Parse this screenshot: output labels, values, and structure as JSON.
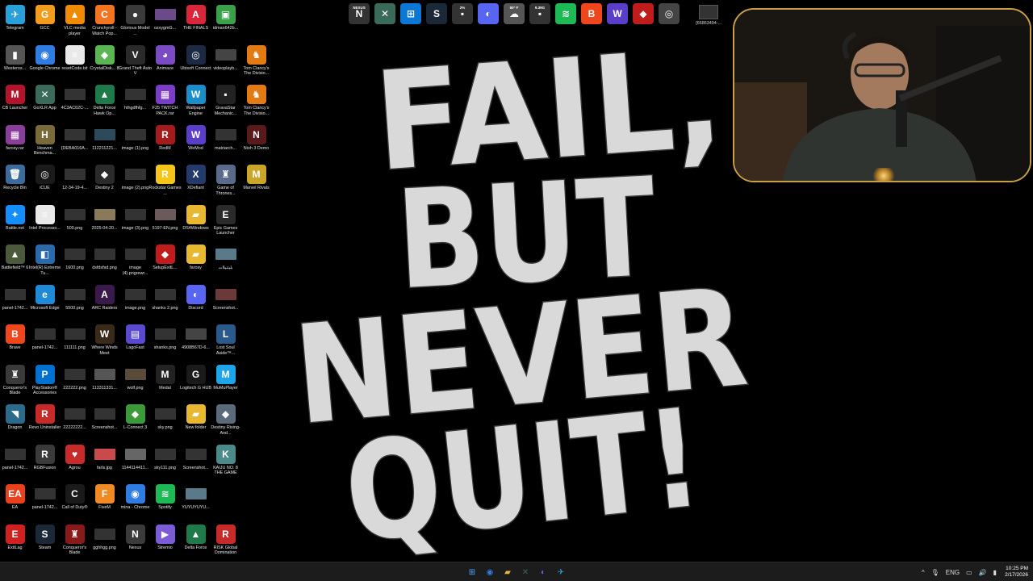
{
  "desktop": {
    "icons": [
      {
        "label": "Telegram",
        "glyph": "✈",
        "color": "#2aa0da",
        "icon": "telegram-icon"
      },
      {
        "label": "GCC",
        "glyph": "G",
        "color": "#f29b1c",
        "icon": "gcc-icon"
      },
      {
        "label": "VLC media player",
        "glyph": "▲",
        "color": "#f08a00",
        "icon": "vlc-icon"
      },
      {
        "label": "Crunchyroll - Watch Pop...",
        "glyph": "C",
        "color": "#f47521",
        "icon": "crunchyroll-icon"
      },
      {
        "label": "Glorious Model ...",
        "glyph": "●",
        "color": "#3a3a3a",
        "icon": "mouse-icon"
      },
      {
        "label": "ozxygmG...",
        "glyph": "☺",
        "color": "#6b4a8a",
        "icon": "image-file-icon"
      },
      {
        "label": "THE FINALS",
        "glyph": "A",
        "color": "#d8263a",
        "icon": "the-finals-icon"
      },
      {
        "label": "idman642b...",
        "glyph": "▣",
        "color": "#3aa04a",
        "icon": "idm-icon"
      },
      {
        "label": "Westeros...",
        "glyph": "▮",
        "color": "#555",
        "icon": "archive-icon"
      },
      {
        "label": "Google Chrome",
        "glyph": "◉",
        "color": "#2f7de1",
        "icon": "chrome-icon"
      },
      {
        "label": "resetCode.txt",
        "glyph": "≡",
        "color": "#e9e9e9",
        "icon": "text-file-icon"
      },
      {
        "label": "CrystalDisk... 8",
        "glyph": "◆",
        "color": "#5ab552",
        "icon": "crystaldisk-icon"
      },
      {
        "label": "Grand Theft Auto V",
        "glyph": "V",
        "color": "#2a2a2a",
        "icon": "gta-icon"
      },
      {
        "label": "Animaze",
        "glyph": "◕",
        "color": "#7a4bc2",
        "icon": "animaze-icon"
      },
      {
        "label": "Ubisoft Connect",
        "glyph": "◎",
        "color": "#1d2a44",
        "icon": "ubisoft-icon"
      },
      {
        "label": "videoplayb...",
        "glyph": "▭",
        "color": "#444",
        "icon": "video-file-icon"
      },
      {
        "label": "Tom Clancy's The Divisio...",
        "glyph": "♞",
        "color": "#e37b14",
        "icon": "division-icon"
      },
      {
        "label": "CB Launcher",
        "glyph": "M",
        "color": "#b3142b",
        "icon": "cb-launcher-icon"
      },
      {
        "label": "GoXLR App",
        "glyph": "✕",
        "color": "#3a6a5a",
        "icon": "goxlr-icon"
      },
      {
        "label": "4C3AC62C-...",
        "glyph": "▭",
        "color": "#333",
        "icon": "image-file-icon"
      },
      {
        "label": "Delta Force Hawk Op...",
        "glyph": "▲",
        "color": "#1f7a4a",
        "icon": "delta-force-icon"
      },
      {
        "label": "hthgdfhfg...",
        "glyph": "▭",
        "color": "#333",
        "icon": "image-file-icon"
      },
      {
        "label": "F25 TWITCH PACK.rar",
        "glyph": "▦",
        "color": "#7b3cc9",
        "icon": "rar-icon"
      },
      {
        "label": "Wallpaper Engine",
        "glyph": "W",
        "color": "#1a8ecb",
        "icon": "wallpaper-engine-icon"
      },
      {
        "label": "GravaStar Mechanic...",
        "glyph": "▪",
        "color": "#222",
        "icon": "gravastar-icon"
      },
      {
        "label": "Tom Clancy's The Divisio...",
        "glyph": "♞",
        "color": "#e37b14",
        "icon": "division-icon"
      },
      {
        "label": "farosy.rar",
        "glyph": "▦",
        "color": "#8a3d9a",
        "icon": "rar-icon"
      },
      {
        "label": "Heaven Benchma...",
        "glyph": "H",
        "color": "#7a6a3a",
        "icon": "heaven-icon"
      },
      {
        "label": "{DEBA016A...",
        "glyph": "▭",
        "color": "#333",
        "icon": "image-file-icon"
      },
      {
        "label": "112211221...",
        "glyph": "▭",
        "color": "#2d4a5a",
        "icon": "image-file-icon"
      },
      {
        "label": "image (1).png",
        "glyph": "▭",
        "color": "#333",
        "icon": "image-file-icon"
      },
      {
        "label": "RedM",
        "glyph": "R",
        "color": "#a51b1b",
        "icon": "redm-icon"
      },
      {
        "label": "WeMod",
        "glyph": "W",
        "color": "#5a3ec9",
        "icon": "wemod-icon"
      },
      {
        "label": "matriarch...",
        "glyph": "▭",
        "color": "#333",
        "icon": "image-file-icon"
      },
      {
        "label": "Nioh 3 Demo",
        "glyph": "N",
        "color": "#5a1a1a",
        "icon": "nioh-icon"
      },
      {
        "label": "Recycle Bin",
        "glyph": "🗑",
        "color": "#3b6b9a",
        "icon": "recycle-bin-icon"
      },
      {
        "label": "iCUE",
        "glyph": "◎",
        "color": "#1a1a1a",
        "icon": "icue-icon"
      },
      {
        "label": "12-34-19-4...",
        "glyph": "▭",
        "color": "#333",
        "icon": "image-file-icon"
      },
      {
        "label": "Destiny 2",
        "glyph": "◆",
        "color": "#2a2a2a",
        "icon": "destiny-icon"
      },
      {
        "label": "image (2).png",
        "glyph": "▭",
        "color": "#333",
        "icon": "image-file-icon"
      },
      {
        "label": "Rockstar Games ...",
        "glyph": "R",
        "color": "#f5c518",
        "icon": "rockstar-icon"
      },
      {
        "label": "XDefiant",
        "glyph": "X",
        "color": "#243a6a",
        "icon": "xdefiant-icon"
      },
      {
        "label": "Game of Thrones...",
        "glyph": "♜",
        "color": "#5a6a8a",
        "icon": "got-icon"
      },
      {
        "label": "Marvel Rivals",
        "glyph": "M",
        "color": "#c9a52a",
        "icon": "marvel-rivals-icon"
      },
      {
        "label": "Battle.net",
        "glyph": "✦",
        "color": "#148eff",
        "icon": "battlenet-icon"
      },
      {
        "label": "Intel Processo...",
        "glyph": "≡",
        "color": "#e9e9e9",
        "icon": "text-file-icon"
      },
      {
        "label": "500.png",
        "glyph": "▭",
        "color": "#333",
        "icon": "image-file-icon"
      },
      {
        "label": "2025-04-20...",
        "glyph": "▭",
        "color": "#8a7a5a",
        "icon": "image-file-icon"
      },
      {
        "label": "image (3).png",
        "glyph": "▭",
        "color": "#333",
        "icon": "image-file-icon"
      },
      {
        "label": "5197-EN.png",
        "glyph": "▭",
        "color": "#6a5a5a",
        "icon": "image-file-icon"
      },
      {
        "label": "DS4Windows",
        "glyph": "▰",
        "color": "#e8b830",
        "icon": "folder-icon"
      },
      {
        "label": "Epic Games Launcher",
        "glyph": "E",
        "color": "#2a2a2a",
        "icon": "epic-icon"
      },
      {
        "label": "Battlefield™ 6",
        "glyph": "▲",
        "color": "#4a5a3a",
        "icon": "battlefield-icon"
      },
      {
        "label": "Intel(R) Extreme Tu...",
        "glyph": "◧",
        "color": "#2a6aaa",
        "icon": "intel-xtu-icon"
      },
      {
        "label": "1600.png",
        "glyph": "▭",
        "color": "#333",
        "icon": "image-file-icon"
      },
      {
        "label": "dsfdsfsd.png",
        "glyph": "▭",
        "color": "#333",
        "icon": "image-file-icon"
      },
      {
        "label": "image (4).pngrewr...",
        "glyph": "▭",
        "color": "#333",
        "icon": "image-file-icon"
      },
      {
        "label": "SetupExitL...",
        "glyph": "◆",
        "color": "#c01c1c",
        "icon": "setup-icon"
      },
      {
        "label": "farosy",
        "glyph": "▰",
        "color": "#e8b830",
        "icon": "folder-icon"
      },
      {
        "label": "بليتنيلات",
        "glyph": "▭",
        "color": "#5a7a8a",
        "icon": "image-file-icon"
      },
      {
        "label": "panel-1742...",
        "glyph": "▭",
        "color": "#333",
        "icon": "image-file-icon"
      },
      {
        "label": "Microsoft Edge",
        "glyph": "e",
        "color": "#1f8bd8",
        "icon": "edge-icon"
      },
      {
        "label": "5500.png",
        "glyph": "▭",
        "color": "#333",
        "icon": "image-file-icon"
      },
      {
        "label": "ARC Raiders",
        "glyph": "A",
        "color": "#3a1a4a",
        "icon": "arc-raiders-icon"
      },
      {
        "label": "image.png",
        "glyph": "▭",
        "color": "#333",
        "icon": "image-file-icon"
      },
      {
        "label": "shanks 2.png",
        "glyph": "▭",
        "color": "#333",
        "icon": "image-file-icon"
      },
      {
        "label": "Discord",
        "glyph": "◐",
        "color": "#5865f2",
        "icon": "discord-icon"
      },
      {
        "label": "Screenshot...",
        "glyph": "▭",
        "color": "#6a3a3a",
        "icon": "image-file-icon"
      },
      {
        "label": "Brave",
        "glyph": "B",
        "color": "#f0461c",
        "icon": "brave-icon"
      },
      {
        "label": "panel-1742...",
        "glyph": "▭",
        "color": "#333",
        "icon": "image-file-icon"
      },
      {
        "label": "111111.png",
        "glyph": "▭",
        "color": "#333",
        "icon": "image-file-icon"
      },
      {
        "label": "Where Winds Meet",
        "glyph": "W",
        "color": "#3a2a1a",
        "icon": "where-winds-meet-icon"
      },
      {
        "label": "LagoFast",
        "glyph": "▤",
        "color": "#5a4ad0",
        "icon": "lagofast-icon"
      },
      {
        "label": "shanks.png",
        "glyph": "▭",
        "color": "#333",
        "icon": "image-file-icon"
      },
      {
        "label": "4908B67D-6...",
        "glyph": "▭",
        "color": "#444",
        "icon": "image-file-icon"
      },
      {
        "label": "Lost Soul Aside™...",
        "glyph": "L",
        "color": "#2a5a8a",
        "icon": "lost-soul-aside-icon"
      },
      {
        "label": "Conqueror's Blade",
        "glyph": "♜",
        "color": "#3a3a3a",
        "icon": "conquerors-blade-icon"
      },
      {
        "label": "PlayStation® Accessories",
        "glyph": "P",
        "color": "#0070d1",
        "icon": "playstation-icon"
      },
      {
        "label": "222222.png",
        "glyph": "▭",
        "color": "#333",
        "icon": "image-file-icon"
      },
      {
        "label": "113311331...",
        "glyph": "▭",
        "color": "#555",
        "icon": "image-file-icon"
      },
      {
        "label": "wolf.png",
        "glyph": "▭",
        "color": "#5a4a3a",
        "icon": "image-file-icon"
      },
      {
        "label": "Medal",
        "glyph": "M",
        "color": "#222",
        "icon": "medal-icon"
      },
      {
        "label": "Logitech G HUB",
        "glyph": "G",
        "color": "#1a1a1a",
        "icon": "ghub-icon"
      },
      {
        "label": "MuMuPlayer",
        "glyph": "M",
        "color": "#1ea4e8",
        "icon": "mumu-icon"
      },
      {
        "label": "Dragon",
        "glyph": "◥",
        "color": "#2a6a8a",
        "icon": "dragon-icon"
      },
      {
        "label": "Revo Uninstaller",
        "glyph": "R",
        "color": "#c82a2a",
        "icon": "revo-icon"
      },
      {
        "label": "22222222...",
        "glyph": "▭",
        "color": "#333",
        "icon": "image-file-icon"
      },
      {
        "label": "Screenshot...",
        "glyph": "▭",
        "color": "#333",
        "icon": "image-file-icon"
      },
      {
        "label": "L-Connect 3",
        "glyph": "◆",
        "color": "#3a9a3a",
        "icon": "lconnect-icon"
      },
      {
        "label": "sky.png",
        "glyph": "▭",
        "color": "#333",
        "icon": "image-file-icon"
      },
      {
        "label": "New folder",
        "glyph": "▰",
        "color": "#e8b830",
        "icon": "folder-icon"
      },
      {
        "label": "Destiny Rising-And...",
        "glyph": "◆",
        "color": "#5a6a7a",
        "icon": "destiny-rising-icon"
      },
      {
        "label": "panel-1742...",
        "glyph": "▭",
        "color": "#333",
        "icon": "image-file-icon"
      },
      {
        "label": "RGBFusion",
        "glyph": "R",
        "color": "#3a3a3a",
        "icon": "rgbfusion-icon"
      },
      {
        "label": "Agrou",
        "glyph": "♥",
        "color": "#c82a2a",
        "icon": "agrou-icon"
      },
      {
        "label": "farls.jpg",
        "glyph": "▭",
        "color": "#c84a4a",
        "icon": "image-file-icon"
      },
      {
        "label": "1144114411...",
        "glyph": "▭",
        "color": "#666",
        "icon": "image-file-icon"
      },
      {
        "label": "sky111.png",
        "glyph": "▭",
        "color": "#333",
        "icon": "image-file-icon"
      },
      {
        "label": "Screenshot...",
        "glyph": "▭",
        "color": "#333",
        "icon": "image-file-icon"
      },
      {
        "label": "KAIJU NO. 8 THE GAME",
        "glyph": "K",
        "color": "#4a8a8a",
        "icon": "kaiju-icon"
      },
      {
        "label": "EA",
        "glyph": "EA",
        "color": "#e8411c",
        "icon": "ea-icon"
      },
      {
        "label": "panel-1742...",
        "glyph": "▭",
        "color": "#333",
        "icon": "image-file-icon"
      },
      {
        "label": "Call of Duty®",
        "glyph": "C",
        "color": "#1a1a1a",
        "icon": "cod-icon"
      },
      {
        "label": "FiveM",
        "glyph": "F",
        "color": "#f08a24",
        "icon": "fivem-icon"
      },
      {
        "label": "mina - Chrome",
        "glyph": "◉",
        "color": "#2f7de1",
        "icon": "chrome-icon"
      },
      {
        "label": "Spotify",
        "glyph": "≋",
        "color": "#1db954",
        "icon": "spotify-icon"
      },
      {
        "label": "YUYUYUYU...",
        "glyph": "▭",
        "color": "#5a7a8a",
        "icon": "image-file-icon"
      },
      {
        "label": "ExitLag",
        "glyph": "E",
        "color": "#d02020",
        "icon": "exitlag-icon"
      },
      {
        "label": "Steam",
        "glyph": "S",
        "color": "#1b2838",
        "icon": "steam-icon"
      },
      {
        "label": "Conqueror's Blade",
        "glyph": "♜",
        "color": "#8a1a1a",
        "icon": "conquerors-blade-icon"
      },
      {
        "label": "gghhgg.png",
        "glyph": "▭",
        "color": "#333",
        "icon": "image-file-icon"
      },
      {
        "label": "Nexus",
        "glyph": "N",
        "color": "#3a3a3a",
        "icon": "nexus-icon"
      },
      {
        "label": "Stremio",
        "glyph": "▶",
        "color": "#7b5bd6",
        "icon": "stremio-icon"
      },
      {
        "label": "Delta Force",
        "glyph": "▲",
        "color": "#1f7a4a",
        "icon": "delta-force-icon"
      },
      {
        "label": "RISK Global Domination",
        "glyph": "R",
        "color": "#c82a2a",
        "icon": "risk-icon"
      }
    ]
  },
  "wallpaper": {
    "lines": [
      "FAIL,",
      "BUT",
      "NEVER",
      "QUIT!"
    ]
  },
  "top_strip": {
    "icons": [
      {
        "glyph": "N",
        "color": "#333",
        "icon": "nexus-icon",
        "mini": "NEXUS"
      },
      {
        "glyph": "✕",
        "color": "#3a6a5a",
        "icon": "goxlr-icon",
        "mini": ""
      },
      {
        "glyph": "⊞",
        "color": "#0a78d4",
        "icon": "windows-icon",
        "mini": ""
      },
      {
        "glyph": "S",
        "color": "#1b2838",
        "icon": "steam-icon",
        "mini": ""
      },
      {
        "glyph": "▪",
        "color": "#333",
        "icon": "cpu-widget-icon",
        "mini": "2%"
      },
      {
        "glyph": "◐",
        "color": "#5865f2",
        "icon": "discord-icon",
        "mini": ""
      },
      {
        "glyph": "☁",
        "color": "#555",
        "icon": "weather-icon",
        "mini": "60° F"
      },
      {
        "glyph": "▪",
        "color": "#333",
        "icon": "memory-widget-icon",
        "mini": "9.39G"
      },
      {
        "glyph": "≋",
        "color": "#1db954",
        "icon": "spotify-icon",
        "mini": ""
      },
      {
        "glyph": "B",
        "color": "#f0461c",
        "icon": "brave-icon",
        "mini": ""
      },
      {
        "glyph": "W",
        "color": "#5a3ec9",
        "icon": "wemod-icon",
        "mini": ""
      },
      {
        "glyph": "◆",
        "color": "#c01c1c",
        "icon": "exitlag-icon",
        "mini": ""
      },
      {
        "glyph": "◎",
        "color": "#444",
        "icon": "obs-icon",
        "mini": ""
      }
    ],
    "tail_label": "{66863494-..."
  },
  "taskbar": {
    "apps": [
      {
        "glyph": "⊞",
        "color": "#4aa3ff",
        "icon": "start-icon"
      },
      {
        "glyph": "◉",
        "color": "#2f7de1",
        "icon": "chrome-icon"
      },
      {
        "glyph": "▰",
        "color": "#e8b830",
        "icon": "file-explorer-icon"
      },
      {
        "glyph": "✕",
        "color": "#3a6a5a",
        "icon": "goxlr-icon"
      },
      {
        "glyph": "◐",
        "color": "#5865f2",
        "icon": "discord-icon"
      },
      {
        "glyph": "✈",
        "color": "#2aa0da",
        "icon": "telegram-icon"
      }
    ],
    "tray": {
      "chevron": "^",
      "mic": "🎙",
      "language": "ENG",
      "network": "▭",
      "volume": "🔊",
      "battery": "▮",
      "time": "10:25 PM",
      "date": "2/17/2026"
    }
  }
}
